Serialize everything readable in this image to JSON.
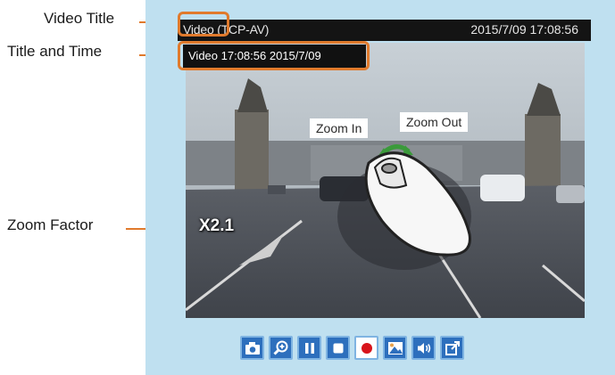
{
  "annotations": {
    "video_title": "Video Title",
    "title_and_time": "Title and Time",
    "zoom_factor": "Zoom Factor"
  },
  "titlebar": {
    "title": "Video (TCP-AV)",
    "time": "2015/7/09  17:08:56"
  },
  "overlay": {
    "caption": "Video 17:08:56  2015/7/09",
    "zoom_factor": "X2.1"
  },
  "mouse_callouts": {
    "zoom_in": "Zoom In",
    "zoom_out": "Zoom Out"
  },
  "toolbar": {
    "buttons": [
      "camera-icon",
      "zoom-in-icon",
      "pause-icon",
      "stop-icon",
      "record-icon",
      "digital-zoom-icon",
      "volume-icon",
      "fullscreen-icon"
    ]
  },
  "colors": {
    "accent": "#e07a2c",
    "panel_bg": "#bfe0f0",
    "button_blue": "#2d6fbd",
    "record_red": "#d8141b"
  }
}
